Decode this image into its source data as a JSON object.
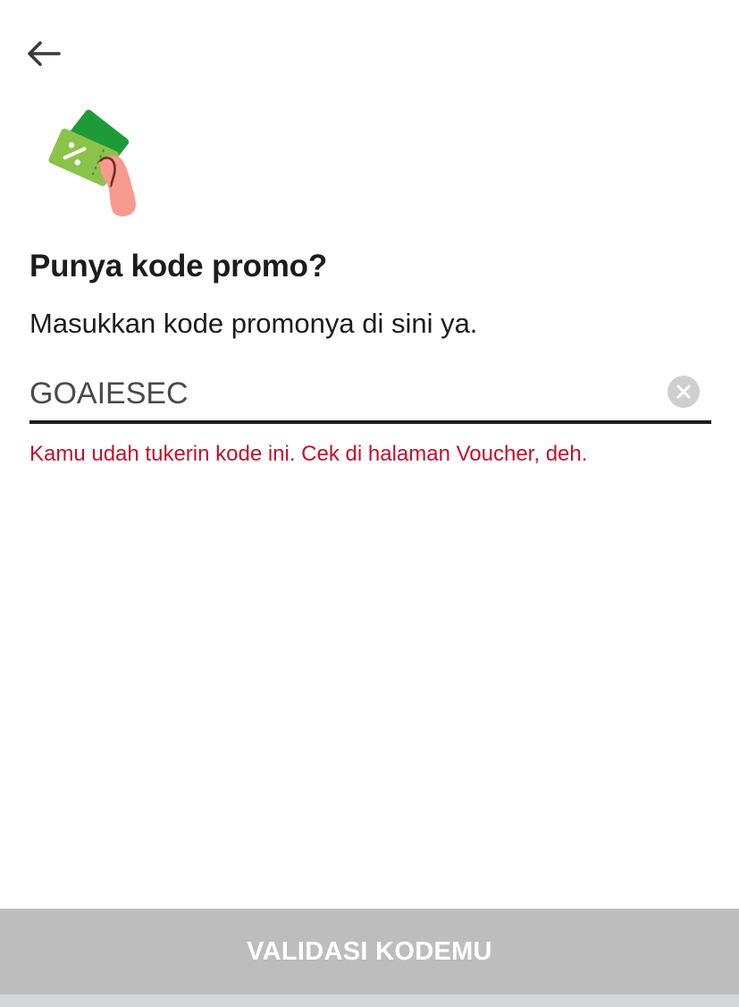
{
  "header": {
    "back_icon": "arrow-left-icon"
  },
  "illustration": {
    "icon": "voucher-in-hand-icon",
    "colors": {
      "voucher_dark": "#1f9a38",
      "voucher_light": "#8bc34a",
      "hand": "#f79a8f"
    }
  },
  "main": {
    "title": "Punya kode promo?",
    "subtitle": "Masukkan kode promonya di sini ya.",
    "promo_input": {
      "value": "GOAIESEC",
      "placeholder": ""
    },
    "clear_icon": "close-circle-icon",
    "error_message": "Kamu udah tukerin kode ini. Cek di halaman Voucher, deh."
  },
  "footer": {
    "button_label": "VALIDASI KODEMU"
  },
  "colors": {
    "text_primary": "#1c1c1c",
    "error": "#c4102a",
    "button_disabled": "#bdbdbd"
  }
}
